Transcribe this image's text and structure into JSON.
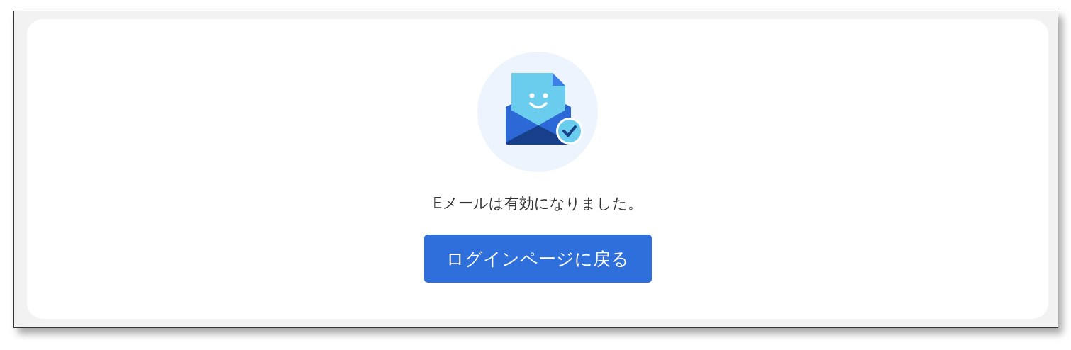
{
  "message": "Eメールは有効になりました。",
  "button": {
    "label": "ログインページに戻る"
  }
}
